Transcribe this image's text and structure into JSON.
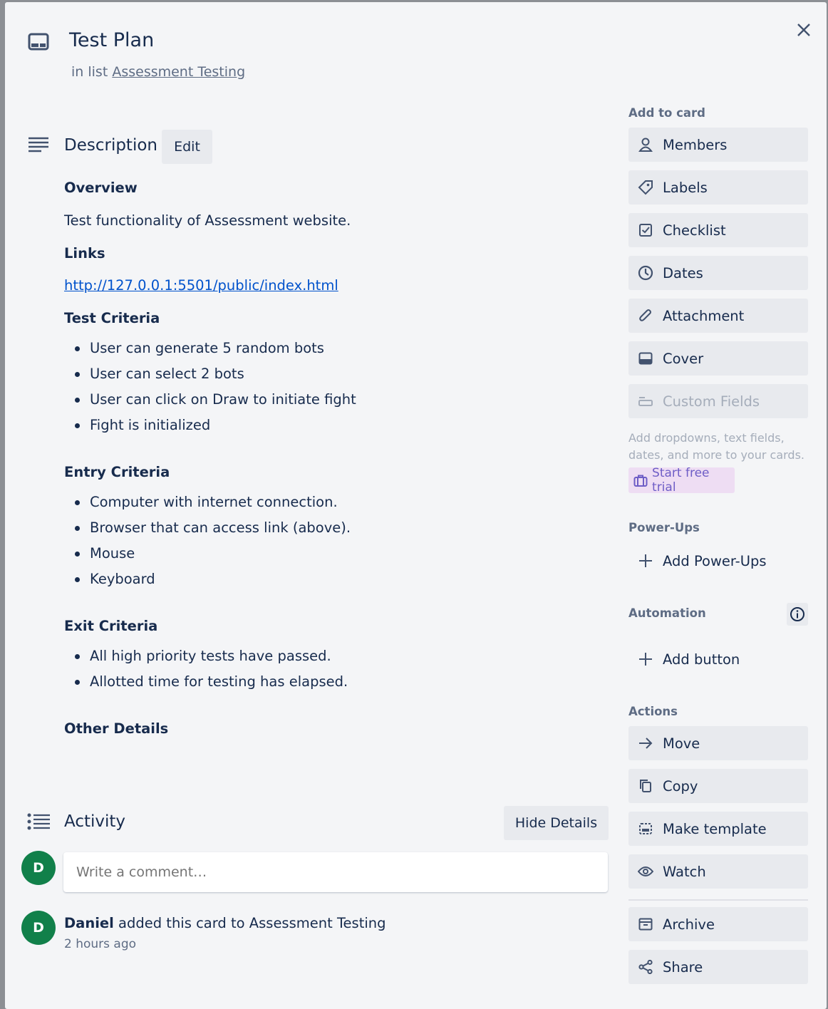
{
  "card": {
    "title": "Test Plan",
    "in_list_prefix": "in list",
    "list_name": "Assessment Testing"
  },
  "description": {
    "heading": "Description",
    "edit_label": "Edit",
    "overview_heading": "Overview",
    "overview_text": "Test functionality of Assessment website.",
    "links_heading": "Links",
    "link": "http://127.0.0.1:5501/public/index.html",
    "test_criteria_heading": "Test Criteria",
    "test_criteria": [
      "User can generate 5 random bots",
      "User can select 2 bots",
      "User can click on Draw to initiate fight",
      "Fight is initialized"
    ],
    "entry_criteria_heading": "Entry Criteria",
    "entry_criteria": [
      "Computer with internet connection.",
      "Browser that can access link (above).",
      "Mouse",
      "Keyboard"
    ],
    "exit_criteria_heading": "Exit Criteria",
    "exit_criteria": [
      "All high priority tests have passed.",
      "Allotted time for testing has elapsed."
    ],
    "other_heading": "Other Details"
  },
  "activity": {
    "heading": "Activity",
    "hide_details_label": "Hide Details",
    "avatar_initial": "D",
    "comment_placeholder": "Write a comment…",
    "entry_user": "Daniel",
    "entry_action": " added this card to Assessment Testing",
    "entry_time": "2 hours ago"
  },
  "sidebar": {
    "add_to_card_heading": "Add to card",
    "members": "Members",
    "labels": "Labels",
    "checklist": "Checklist",
    "dates": "Dates",
    "attachment": "Attachment",
    "cover": "Cover",
    "custom_fields": "Custom Fields",
    "custom_fields_desc": "Add dropdowns, text fields, dates, and more to your cards.",
    "start_trial": "Start free trial",
    "powerups_heading": "Power-Ups",
    "add_powerups": "Add Power-Ups",
    "automation_heading": "Automation",
    "add_button": "Add button",
    "actions_heading": "Actions",
    "move": "Move",
    "copy": "Copy",
    "make_template": "Make template",
    "watch": "Watch",
    "archive": "Archive",
    "share": "Share"
  },
  "colors": {
    "avatar": "#11804a",
    "link": "#0052cc",
    "trial_bg": "#eeddf3",
    "trial_text": "#6e5dc6"
  }
}
